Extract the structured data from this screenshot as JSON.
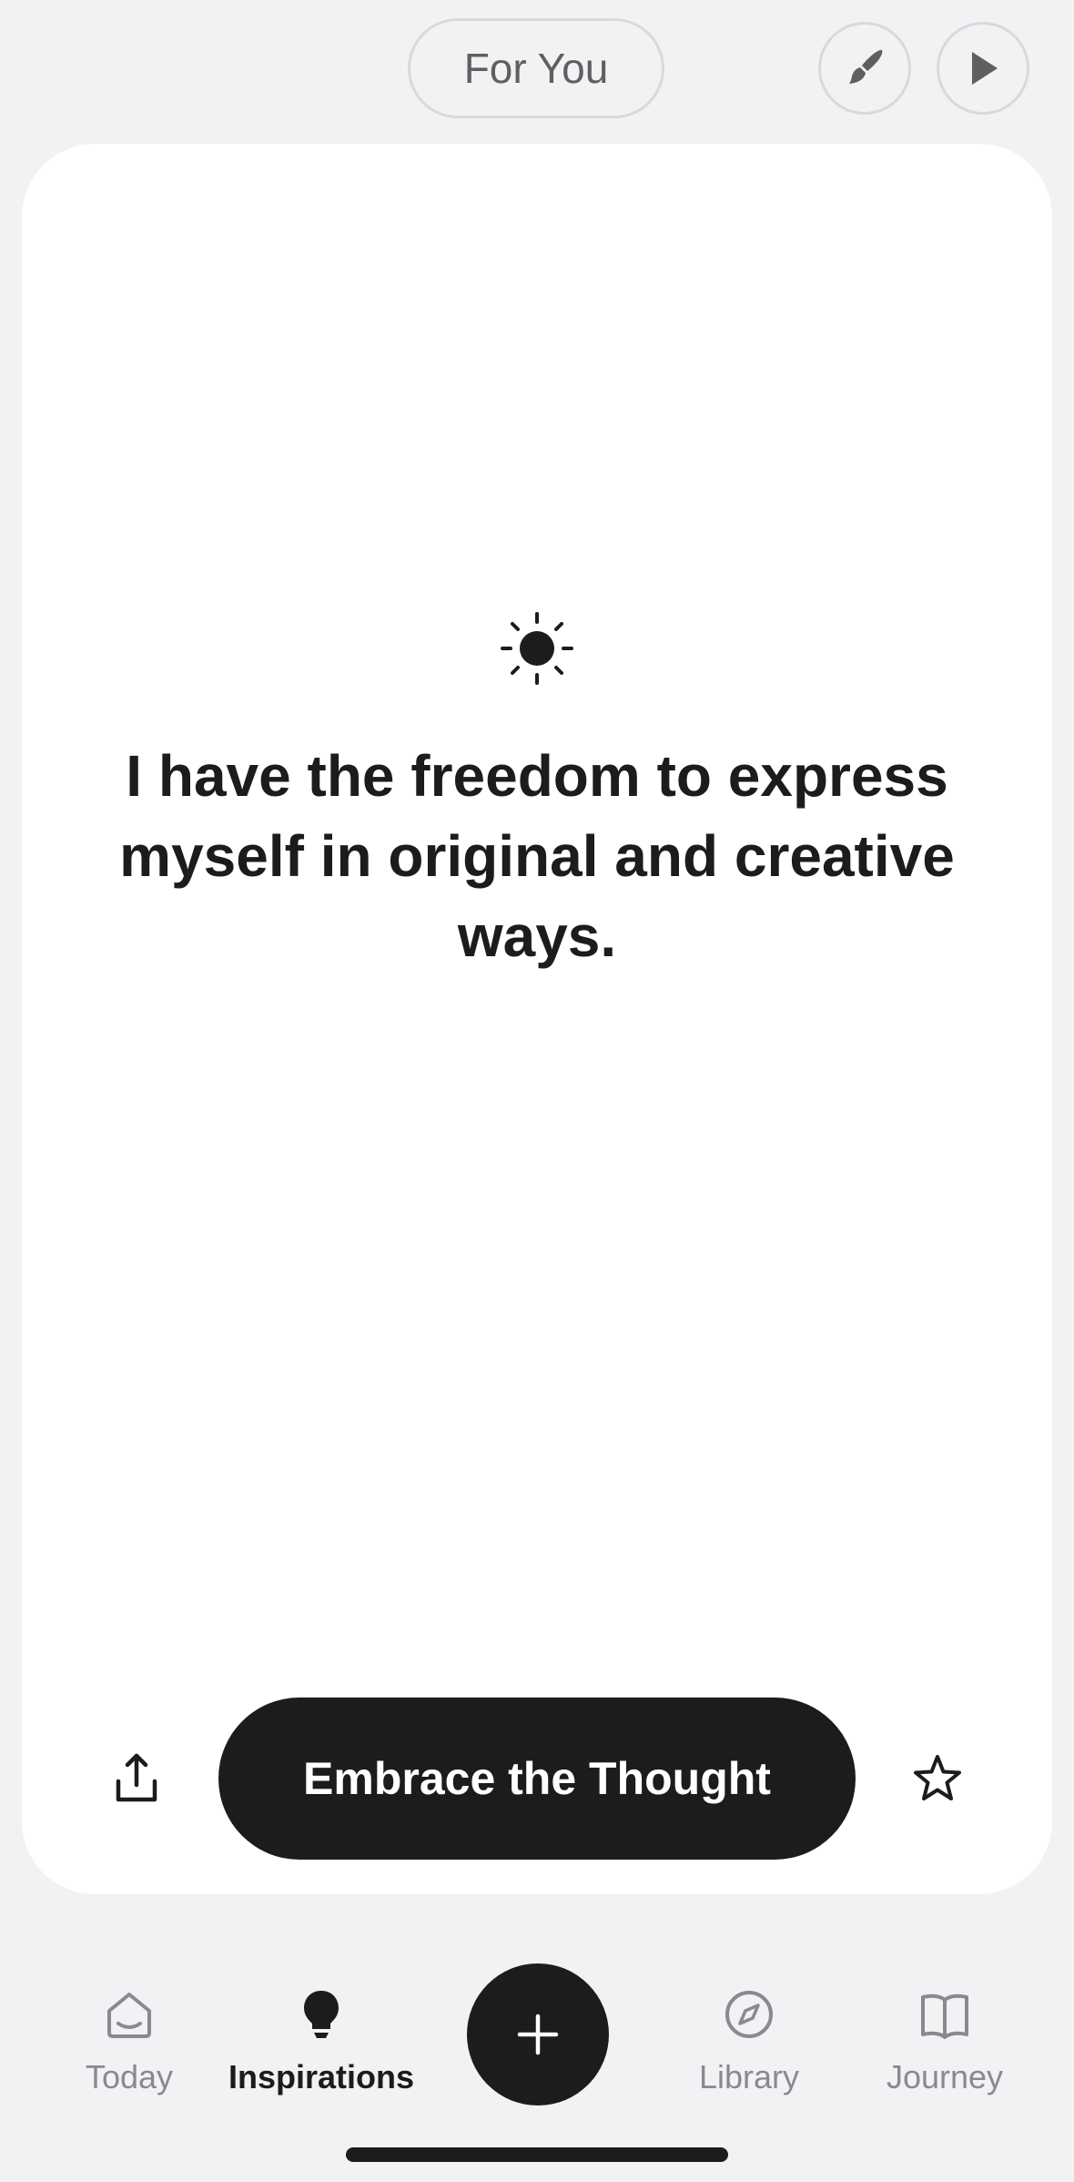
{
  "header": {
    "feed_label": "For You",
    "brush_icon": "paintbrush-icon",
    "play_icon": "play-icon"
  },
  "card": {
    "icon": "sun-icon",
    "quote": "I have the freedom to express myself in original and creative ways.",
    "share_icon": "share-icon",
    "action_label": "Embrace the Thought",
    "favorite_icon": "star-icon"
  },
  "tabs": [
    {
      "label": "Today",
      "icon": "home-icon",
      "active": false
    },
    {
      "label": "Inspirations",
      "icon": "lightbulb-icon",
      "active": true
    },
    {
      "label": "Library",
      "icon": "compass-icon",
      "active": false
    },
    {
      "label": "Journey",
      "icon": "book-icon",
      "active": false
    }
  ],
  "add_button_icon": "plus-icon",
  "colors": {
    "background": "#f1f2f4",
    "card": "#ffffff",
    "primary": "#1c1b1d",
    "muted": "#8a8a8e"
  }
}
